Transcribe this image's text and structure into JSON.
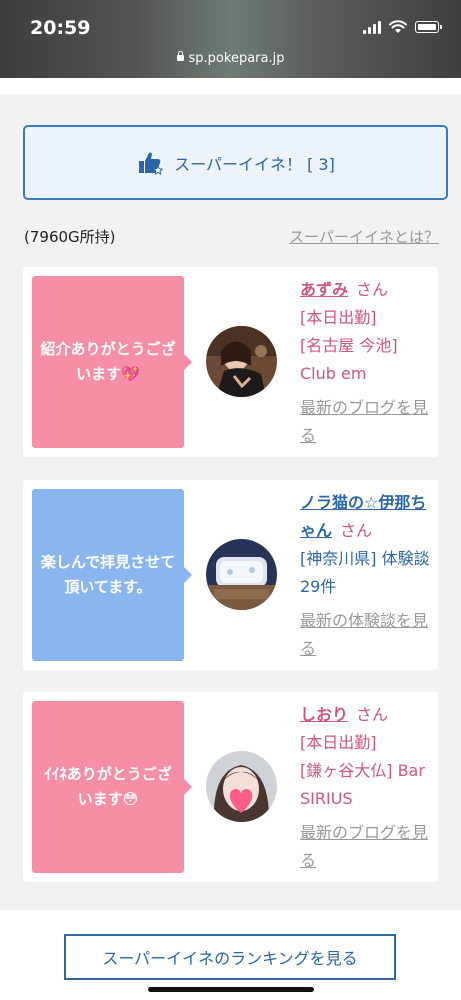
{
  "status_bar": {
    "time": "20:59",
    "url": "sp.pokepara.jp"
  },
  "super_iine_button": {
    "label": "スーパーイイネ！ [ 3]"
  },
  "points": {
    "owned": "(7960G所持)",
    "what_is_link": "スーパーイイネとは？"
  },
  "cards": [
    {
      "message": "紹介ありがとうございます💖",
      "name": "あずみ",
      "honorific": "さん",
      "line1": "[本日出勤]",
      "line2": "[名古屋 今池] Club em",
      "link": "最新のブログを見る",
      "theme": "pink"
    },
    {
      "message": "楽しんで拝見させて頂いてます。",
      "name": "ノラ猫の☆伊那ちゃん",
      "honorific": "さん",
      "line1": "[神奈川県] 体験談 29件",
      "line2": "",
      "link": "最新の体験談を見る",
      "theme": "blue"
    },
    {
      "message": "ｲｲﾈありがとうございます😳",
      "name": "しおり",
      "honorific": "さん",
      "line1": "[本日出勤]",
      "line2": "[鎌ヶ谷大仏] Bar SIRIUS",
      "link": "最新のブログを見る",
      "theme": "pink"
    }
  ],
  "ranking_button": {
    "label": "スーパーイイネのランキングを見る"
  },
  "colors": {
    "accent_blue": "#2a66a8",
    "pink": "#f68fa5",
    "light_blue": "#8ab6f0",
    "name_pink": "#d0567c"
  }
}
